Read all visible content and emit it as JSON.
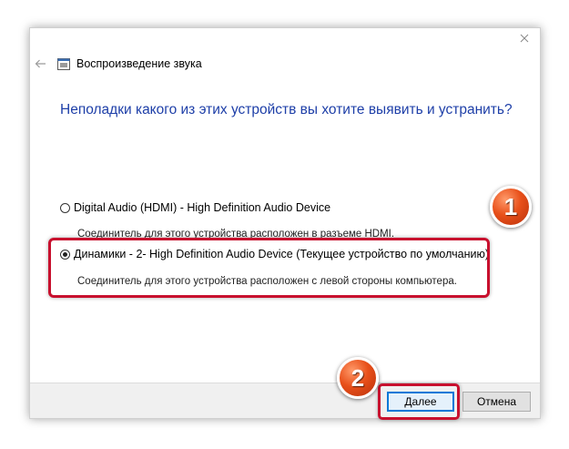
{
  "window": {
    "title": "Воспроизведение звука",
    "question": "Неполадки какого из этих устройств вы хотите выявить и устранить?"
  },
  "options": [
    {
      "label": "Digital Audio (HDMI) - High Definition Audio Device",
      "description": "Соединитель для этого устройства расположен в разъеме HDMI.",
      "selected": false
    },
    {
      "label": "Динамики - 2- High Definition Audio Device (Текущее устройство по умолчанию)",
      "description": "Соединитель для этого устройства расположен с левой стороны компьютера.",
      "selected": true
    }
  ],
  "buttons": {
    "next": "Далее",
    "cancel": "Отмена"
  },
  "annotations": {
    "badge1": "1",
    "badge2": "2",
    "color": "#c8102e"
  },
  "icons": {
    "close": "close-icon",
    "back": "back-arrow-icon",
    "app": "speaker-app-icon"
  }
}
